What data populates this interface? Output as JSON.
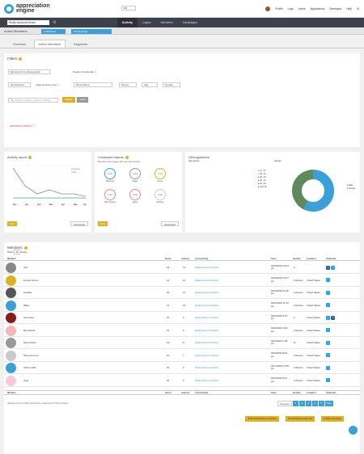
{
  "header": {
    "logo_line1": "appreciation",
    "logo_line2": "engine",
    "language": "EN",
    "user": "Profile",
    "links": [
      "Logs",
      "Users",
      "Applications",
      "Developer",
      "Help"
    ]
  },
  "brand_selector": "Really Awesome Brand",
  "settings_icon": "gear-icon",
  "main_nav": [
    "Activity",
    "Logins",
    "Members",
    "Campaigns"
  ],
  "subheader": {
    "title": "Active Members",
    "segment_btn": "1,000 Fans",
    "campaign_btn": "All Campaign"
  },
  "tabs": [
    "Overview",
    "Active Members",
    "Segments"
  ],
  "filters": {
    "title": "Filters",
    "members_select": "Members from all segments",
    "opted_in": "Opted-in for Emails",
    "channels": "All Channels",
    "past_services": "Past services only",
    "countries": "All countries",
    "period": "Period",
    "age": "Age",
    "gender": "Gender",
    "search_placeholder": "Search by name, email or mailing...",
    "search_btn": "Search",
    "clear_btn": "Clear",
    "advanced": "Advanced search"
  },
  "activity_report": {
    "title": "Activity report",
    "legend": [
      "Facebook",
      "Twitter"
    ],
    "months": [
      "Dec",
      "Jan",
      "Feb",
      "Mar",
      "Apr",
      "May",
      "Jun"
    ],
    "filter_btn": "Filter",
    "download_btn": "Download"
  },
  "crossover": {
    "title": "Crossover brands",
    "subtitle": "Members who engage with your other brands",
    "brands": [
      {
        "name": "Starbucks",
        "pct": "9.1%"
      },
      {
        "name": "Target",
        "pct": "3.8%"
      },
      {
        "name": "Disney",
        "pct": "1.5%"
      },
      {
        "name": "AMC Theatres",
        "pct": "1.8%"
      },
      {
        "name": "Macys",
        "pct": "0.2%"
      },
      {
        "name": "Old Navy",
        "pct": "0.5%"
      }
    ],
    "filter_btn": "Filter",
    "download_btn": "Download"
  },
  "demographics": {
    "title": "Demographics",
    "age_label": "Age groups",
    "gender_label": "Gender",
    "age_groups": [
      "13 - 17",
      "18 - 24",
      "25 - 34",
      "35 - 44",
      "45 - 54",
      "Over 45"
    ],
    "genders": [
      "Male",
      "Female"
    ]
  },
  "members": {
    "title": "Members",
    "show_label": "Show",
    "show_value": "10",
    "rows_label": "Rows",
    "columns": [
      "Member",
      "Score",
      "Actions",
      "Last activity",
      "Time",
      "Gender",
      "Location",
      "Channels"
    ],
    "rows": [
      {
        "name": "Jeff",
        "score": "43",
        "actions": "13",
        "activity": "Really Awesome Brand",
        "time": "02/19/2016 12:44 pm",
        "gender": "F",
        "location": "",
        "channels": "fb,tw",
        "color": "#888"
      },
      {
        "name": "Human Person",
        "score": "31",
        "actions": "10",
        "activity": "Really Awesome Brand",
        "time": "02/19/2016 12:47 pm",
        "gender": "Unknown",
        "location": "United States",
        "channels": "tw",
        "color": "#e0b020"
      },
      {
        "name": "Annabel",
        "score": "35",
        "actions": "11",
        "activity": "Really Awesome Brand",
        "time": "02/19/2016 11:38 am",
        "gender": "Unknown",
        "location": "United States",
        "channels": "tw",
        "color": "#555"
      },
      {
        "name": "Albert",
        "score": "31",
        "actions": "10",
        "activity": "Really Awesome Brand",
        "time": "02/19/2016 11:33 am",
        "gender": "Unknown",
        "location": "United States",
        "channels": "tw",
        "color": "#3aa0d8"
      },
      {
        "name": "Username",
        "score": "30",
        "actions": "9",
        "activity": "Really Awesome Brand",
        "time": "02/19/2016 9:47 pm",
        "gender": "F",
        "location": "United States",
        "channels": "tw,fb",
        "color": "#8b1a1a"
      },
      {
        "name": "My Android",
        "score": "34",
        "actions": "9",
        "activity": "Really Awesome Brand",
        "time": "02/19/2016 2:02 am",
        "gender": "Unknown",
        "location": "United States",
        "channels": "tw",
        "color": "#f4b6b6"
      },
      {
        "name": "Name Name",
        "score": "33",
        "actions": "8",
        "activity": "Really Awesome Brand",
        "time": "02/19/2016 1:48 pm",
        "gender": "M",
        "location": "United States",
        "channels": "tw",
        "color": "#999"
      },
      {
        "name": "Simmmmmmm",
        "score": "32",
        "actions": "7",
        "activity": "Really Awesome Brand",
        "time": "02/19/2016 8:22 pm",
        "gender": "Unknown",
        "location": "United States",
        "channels": "tw",
        "color": "#c8ccc8"
      },
      {
        "name": "Sister Judith",
        "score": "30",
        "actions": "9",
        "activity": "Really Awesome Brand",
        "time": "02/17/2016 12:55 pm",
        "gender": "Unknown",
        "location": "United States",
        "channels": "tw",
        "color": "#3aa0d8"
      },
      {
        "name": "Greg",
        "score": "30",
        "actions": "9",
        "activity": "Really Awesome Brand",
        "time": "02/19/2016 8:37 pm",
        "gender": "Unknown",
        "location": "United States",
        "channels": "tw",
        "color": "#f9c9d4"
      }
    ],
    "footer_text": "Showing 1 to 10 of 684 entries from a total count of 684 members",
    "pager": [
      "Previous",
      "1",
      "2",
      "3",
      "4",
      "5",
      "Next"
    ],
    "btn_download_members": "Download these members",
    "btn_download_emails": "Download emails only",
    "btn_start_campaign": "Start campaign"
  }
}
